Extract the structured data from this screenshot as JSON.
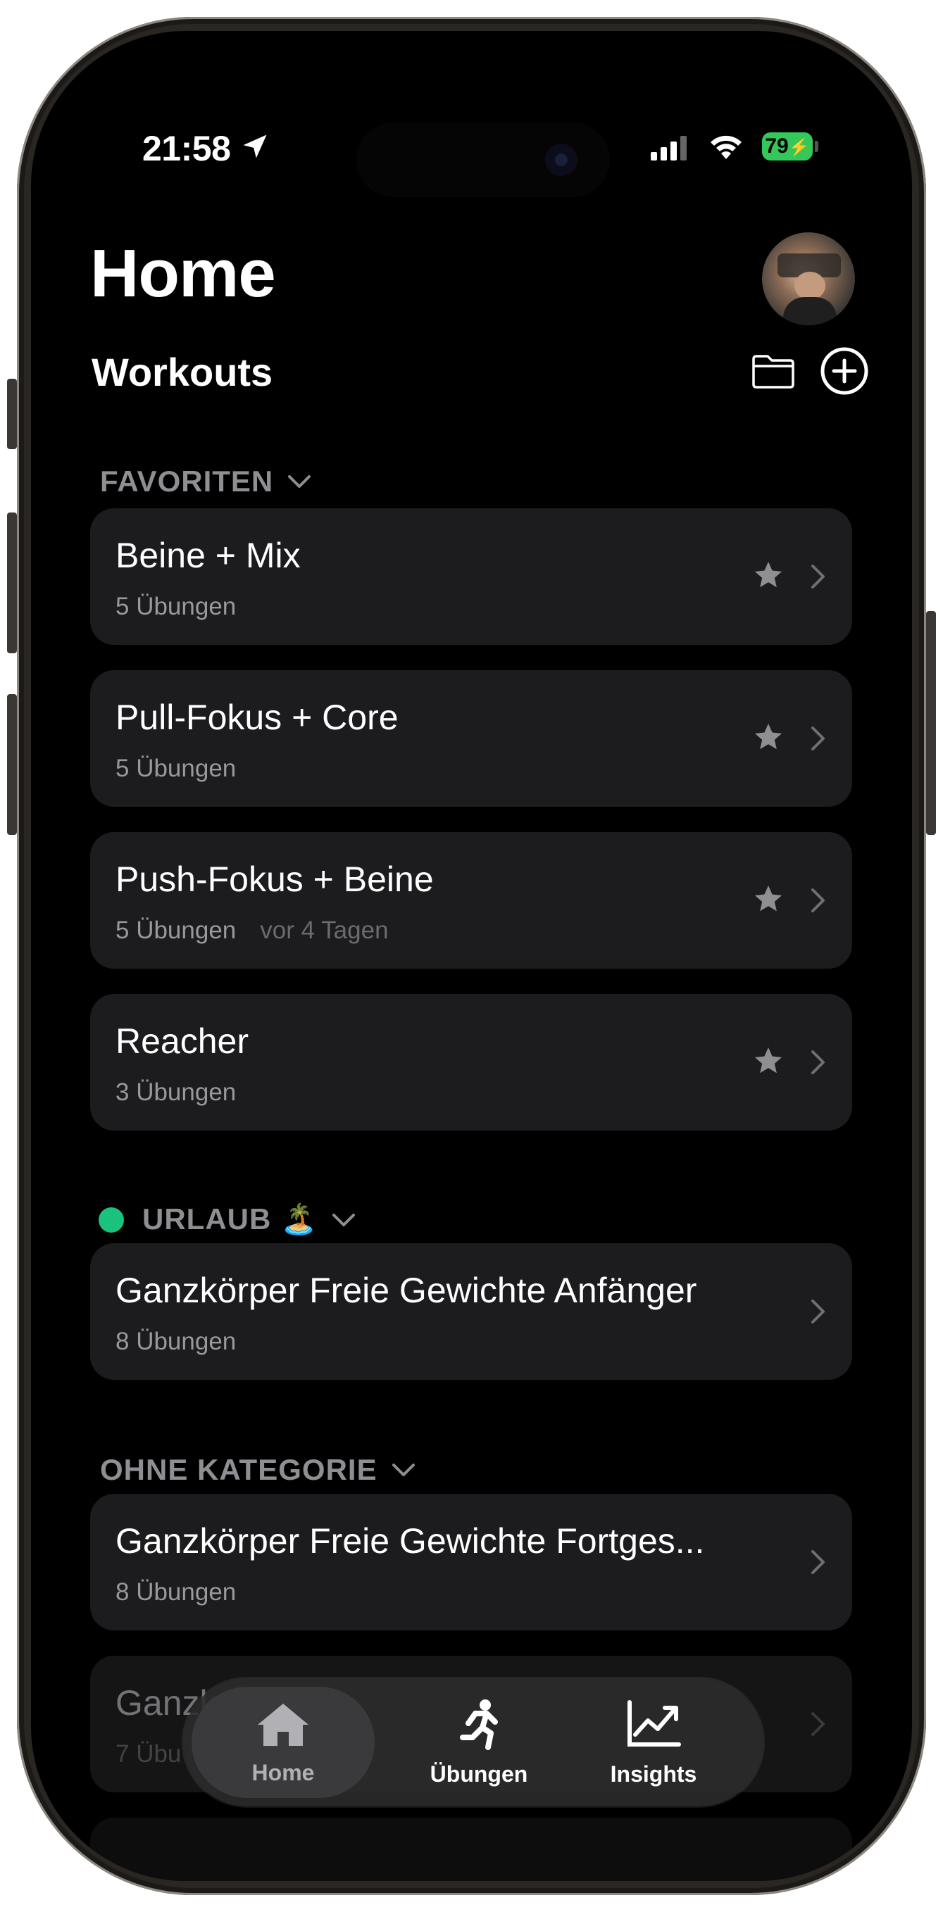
{
  "status_bar": {
    "time": "21:58",
    "battery": "79"
  },
  "header": {
    "title": "Home",
    "subtitle": "Workouts"
  },
  "sections": [
    {
      "label": "FAVORITEN",
      "items": [
        {
          "name": "Beine + Mix",
          "meta": "5 Übungen",
          "ago": "",
          "favorite": true
        },
        {
          "name": "Pull-Fokus + Core",
          "meta": "5 Übungen",
          "ago": "",
          "favorite": true
        },
        {
          "name": "Push-Fokus + Beine",
          "meta": "5 Übungen",
          "ago": "vor 4 Tagen",
          "favorite": true
        },
        {
          "name": "Reacher",
          "meta": "3 Übungen",
          "ago": "",
          "favorite": true
        }
      ]
    },
    {
      "label": "URLAUB 🏝️",
      "color": "#19c37d",
      "items": [
        {
          "name": "Ganzkörper Freie Gewichte Anfänger",
          "meta": "8 Übungen",
          "favorite": false
        }
      ]
    },
    {
      "label": "OHNE KATEGORIE",
      "items": [
        {
          "name": "Ganzkörper Freie Gewichte Fortges...",
          "meta": "8 Übungen",
          "favorite": false
        },
        {
          "name": "Ganzk",
          "meta": "7 Übu",
          "favorite": false
        }
      ]
    }
  ],
  "tabbar": {
    "tabs": [
      {
        "label": "Home",
        "icon": "house-icon",
        "active": true
      },
      {
        "label": "Übungen",
        "icon": "running-figure-icon",
        "active": false
      },
      {
        "label": "Insights",
        "icon": "chart-line-icon",
        "active": false
      }
    ]
  }
}
